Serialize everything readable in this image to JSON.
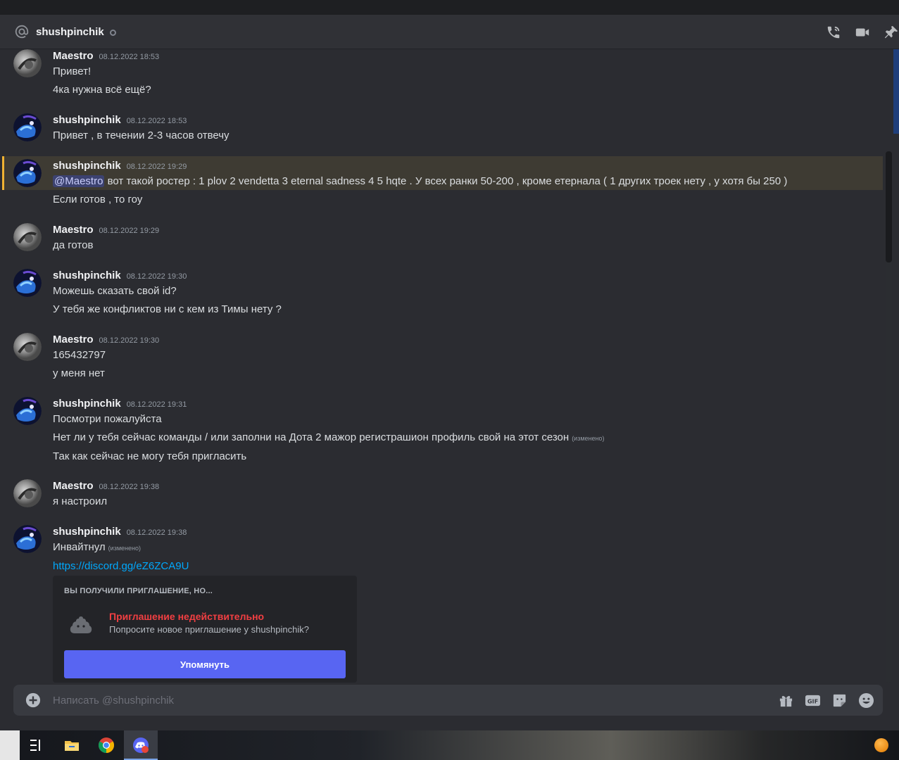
{
  "header": {
    "channel_name": "shushpinchik"
  },
  "messages": [
    {
      "author": "Maestro",
      "timestamp": "08.12.2022 18:53",
      "avatar": "gray-ring",
      "lines": [
        {
          "text": "Привет!"
        },
        {
          "text": "4ка нужна всё ещё?"
        }
      ]
    },
    {
      "author": "shushpinchik",
      "timestamp": "08.12.2022 18:53",
      "avatar": "blue-anime",
      "lines": [
        {
          "text": "Привет , в течении 2-3 часов отвечу"
        }
      ]
    },
    {
      "author": "shushpinchik",
      "timestamp": "08.12.2022 19:29",
      "avatar": "blue-anime",
      "highlighted": true,
      "lines": [
        {
          "mention": "@Maestro",
          "text": " вот такой ростер : 1 plov 2 vendetta 3 eternal sadness 4 5 hqte . У всех ранки 50-200 , кроме етернала ( 1 других троек нету , у хотя бы 250 )"
        },
        {
          "text": "Если готов , то гоу"
        }
      ]
    },
    {
      "author": "Maestro",
      "timestamp": "08.12.2022 19:29",
      "avatar": "gray-ring",
      "lines": [
        {
          "text": "да готов"
        }
      ]
    },
    {
      "author": "shushpinchik",
      "timestamp": "08.12.2022 19:30",
      "avatar": "blue-anime",
      "lines": [
        {
          "text": "Можешь сказать свой id?"
        },
        {
          "text": "У тебя же конфликтов ни с кем из Тимы нету ?"
        }
      ]
    },
    {
      "author": "Maestro",
      "timestamp": "08.12.2022 19:30",
      "avatar": "gray-ring",
      "lines": [
        {
          "text": "165432797"
        },
        {
          "text": "у меня нет"
        }
      ]
    },
    {
      "author": "shushpinchik",
      "timestamp": "08.12.2022 19:31",
      "avatar": "blue-anime",
      "lines": [
        {
          "text": "Посмотри пожалуйста"
        },
        {
          "text": "Нет ли у тебя сейчас команды / или заполни на Дота 2 мажор регистрашион профиль свой на этот сезон",
          "edited": "(изменено)"
        },
        {
          "text": "Так как сейчас не могу тебя пригласить"
        }
      ]
    },
    {
      "author": "Maestro",
      "timestamp": "08.12.2022 19:38",
      "avatar": "gray-ring",
      "lines": [
        {
          "text": "я настроил"
        }
      ]
    },
    {
      "author": "shushpinchik",
      "timestamp": "08.12.2022 19:38",
      "avatar": "blue-anime",
      "lines": [
        {
          "text": "Инвайтнул",
          "edited": "(изменено)"
        },
        {
          "link": "https://discord.gg/eZ6ZCA9U"
        }
      ]
    }
  ],
  "invite": {
    "heading": "ВЫ ПОЛУЧИЛИ ПРИГЛАШЕНИЕ, НО...",
    "title": "Приглашение недействительно",
    "subtitle": "Попросите новое приглашение у shushpinchik?",
    "button_label": "Упомянуть"
  },
  "composer": {
    "placeholder": "Написать @shushpinchik"
  },
  "colors": {
    "accent": "#5865f2",
    "error": "#f23f42",
    "link": "#00a8fc",
    "mention_highlight": "#f0b232"
  },
  "icons": [
    "at-icon",
    "status-offline-icon",
    "voice-call-icon",
    "video-call-icon",
    "pin-icon",
    "add-attachment-icon",
    "gift-icon",
    "gif-icon",
    "sticker-icon",
    "emoji-icon",
    "poop-icon",
    "task-view-icon",
    "file-explorer-icon",
    "chrome-icon",
    "discord-icon"
  ]
}
